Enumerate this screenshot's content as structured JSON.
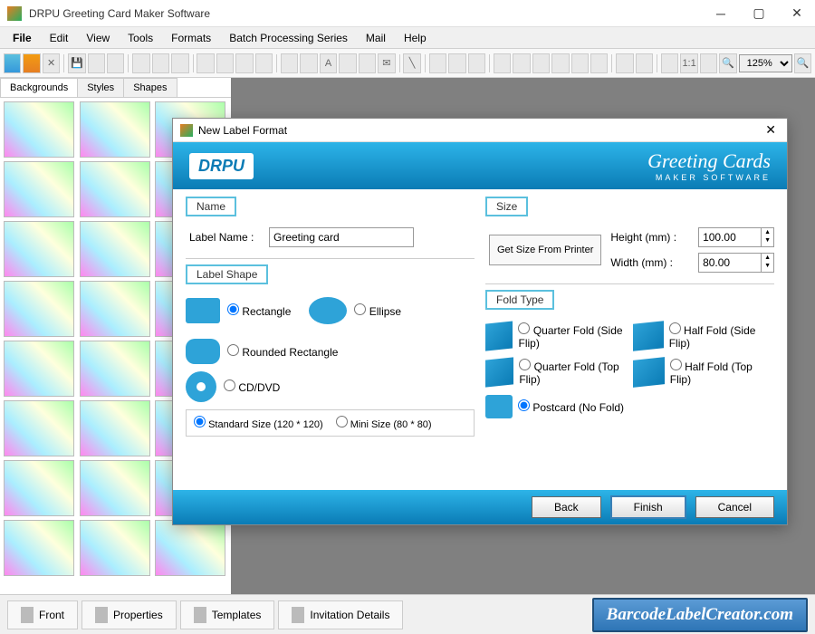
{
  "app": {
    "title": "DRPU Greeting Card Maker Software"
  },
  "menu": [
    "File",
    "Edit",
    "View",
    "Tools",
    "Formats",
    "Batch Processing Series",
    "Mail",
    "Help"
  ],
  "toolbar": {
    "zoom": "125%"
  },
  "side_tabs": [
    "Backgrounds",
    "Styles",
    "Shapes"
  ],
  "bottom_tabs": [
    "Front",
    "Properties",
    "Templates",
    "Invitation Details"
  ],
  "watermark": "BarcodeLabelCreator.com",
  "dialog": {
    "title": "New Label Format",
    "logo": "DRPU",
    "brand": "Greeting Cards",
    "brand_sub": "MAKER SOFTWARE",
    "groups": {
      "name": "Name",
      "size": "Size",
      "shape": "Label Shape",
      "fold": "Fold Type"
    },
    "name": {
      "label": "Label Name :",
      "value": "Greeting card"
    },
    "size": {
      "height_label": "Height (mm) :",
      "height": "100.00",
      "width_label": "Width (mm) :",
      "width": "80.00",
      "printer_btn": "Get Size From Printer"
    },
    "shapes": {
      "rectangle": "Rectangle",
      "ellipse": "Ellipse",
      "rounded": "Rounded Rectangle",
      "cd": "CD/DVD",
      "std": "Standard Size (120 * 120)",
      "mini": "Mini Size (80 * 80)"
    },
    "folds": {
      "qside": "Quarter Fold (Side Flip)",
      "hside": "Half Fold (Side Flip)",
      "qtop": "Quarter Fold (Top Flip)",
      "htop": "Half Fold (Top Flip)",
      "post": "Postcard (No Fold)"
    },
    "buttons": {
      "back": "Back",
      "finish": "Finish",
      "cancel": "Cancel"
    }
  }
}
